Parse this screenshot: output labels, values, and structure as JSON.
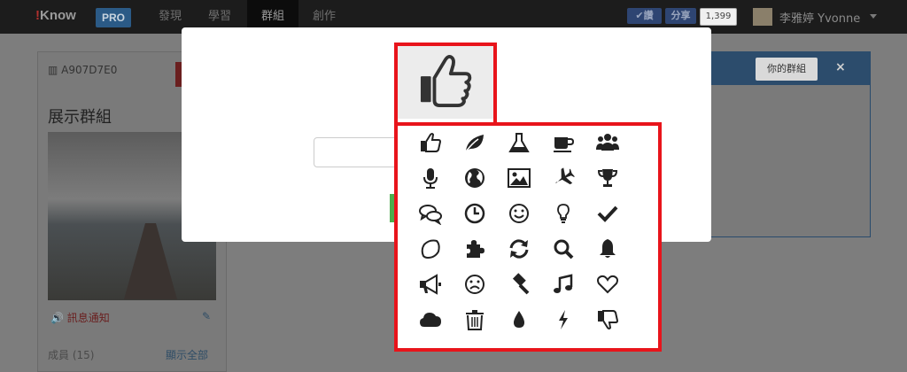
{
  "nav": {
    "logo_mark": "!",
    "logo_text": "Know",
    "pro_badge": "PRO",
    "items": [
      "發現",
      "學習",
      "群組",
      "創作"
    ],
    "active_item": "群組",
    "fb_like": "✔讚",
    "fb_share": "分享",
    "fb_count": "1,399",
    "user_name": "李雅婷 Yvonne"
  },
  "left_card": {
    "code": "▥ A907D7E0",
    "title": "展示群組",
    "notify": "🔊 訊息通知",
    "edit_icon": "pencil-icon",
    "members": "成員 (15)",
    "show_all": "顯示全部"
  },
  "right_panel": {
    "your_group_button": "你的群組",
    "close": "×"
  },
  "icon_picker": {
    "selected_icon": "thumbs-up",
    "border_color": "#e8141b",
    "icons": [
      [
        "thumbs-up",
        "leaf",
        "flask",
        "coffee",
        "users"
      ],
      [
        "microphone",
        "globe",
        "picture",
        "plane",
        "trophy"
      ],
      [
        "comments",
        "clock",
        "smile",
        "lightbulb",
        "check"
      ],
      [
        "lemon",
        "puzzle",
        "refresh",
        "search",
        "bell"
      ],
      [
        "bullhorn",
        "frown",
        "gavel",
        "music",
        "heart"
      ],
      [
        "cloud",
        "trash",
        "tint",
        "bolt",
        "thumbs-down"
      ]
    ]
  }
}
